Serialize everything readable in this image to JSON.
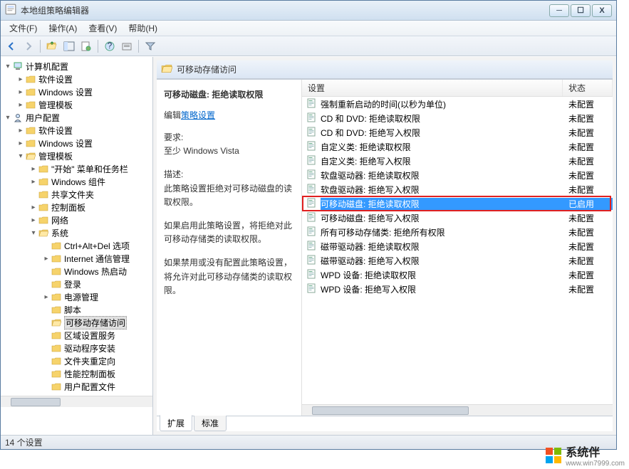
{
  "window": {
    "title": "本地组策略编辑器",
    "controls": {
      "min": "─",
      "max": "☐",
      "close": "X"
    }
  },
  "menu": {
    "file": "文件(F)",
    "action": "操作(A)",
    "view": "查看(V)",
    "help": "帮助(H)"
  },
  "tree": {
    "root1": "计算机配置",
    "r1_soft": "软件设置",
    "r1_win": "Windows 设置",
    "r1_admin": "管理模板",
    "root2": "用户配置",
    "r2_soft": "软件设置",
    "r2_win": "Windows 设置",
    "r2_admin": "管理模板",
    "start": "\"开始\" 菜单和任务栏",
    "wincomp": "Windows 组件",
    "shared": "共享文件夹",
    "ctrlpanel": "控制面板",
    "network": "网络",
    "system": "系统",
    "cad": "Ctrl+Alt+Del 选项",
    "inetcomm": "Internet 通信管理",
    "hotstart": "Windows 热启动",
    "login": "登录",
    "power": "电源管理",
    "script": "脚本",
    "removable": "可移动存储访问",
    "regional": "区域设置服务",
    "driver": "驱动程序安装",
    "folderredir": "文件夹重定向",
    "perfpanel": "性能控制面板",
    "userprofile": "用户配置文件"
  },
  "header": {
    "title": "可移动存储访问"
  },
  "desc": {
    "policy_title": "可移动磁盘: 拒绝读取权限",
    "edit_prefix": "编辑",
    "edit_link": "策略设置",
    "req_label": "要求:",
    "req_value": "至少 Windows Vista",
    "desc_label": "描述:",
    "desc_body1": "此策略设置拒绝对可移动磁盘的读取权限。",
    "desc_body2": "如果启用此策略设置，将拒绝对此可移动存储类的读取权限。",
    "desc_body3": "如果禁用或没有配置此策略设置，将允许对此可移动存储类的读取权限。"
  },
  "columns": {
    "name": "设置",
    "state": "状态"
  },
  "policies": [
    {
      "name": "强制重新启动的时间(以秒为单位)",
      "state": "未配置"
    },
    {
      "name": "CD 和 DVD: 拒绝读取权限",
      "state": "未配置"
    },
    {
      "name": "CD 和 DVD: 拒绝写入权限",
      "state": "未配置"
    },
    {
      "name": "自定义类: 拒绝读取权限",
      "state": "未配置"
    },
    {
      "name": "自定义类: 拒绝写入权限",
      "state": "未配置"
    },
    {
      "name": "软盘驱动器: 拒绝读取权限",
      "state": "未配置"
    },
    {
      "name": "软盘驱动器: 拒绝写入权限",
      "state": "未配置"
    },
    {
      "name": "可移动磁盘: 拒绝读取权限",
      "state": "已启用",
      "highlight": true
    },
    {
      "name": "可移动磁盘: 拒绝写入权限",
      "state": "未配置"
    },
    {
      "name": "所有可移动存储类: 拒绝所有权限",
      "state": "未配置"
    },
    {
      "name": "磁带驱动器: 拒绝读取权限",
      "state": "未配置"
    },
    {
      "name": "磁带驱动器: 拒绝写入权限",
      "state": "未配置"
    },
    {
      "name": "WPD 设备: 拒绝读取权限",
      "state": "未配置"
    },
    {
      "name": "WPD 设备: 拒绝写入权限",
      "state": "未配置"
    }
  ],
  "tabs": {
    "extended": "扩展",
    "standard": "标准"
  },
  "status": {
    "count": "14 个设置"
  },
  "watermark": {
    "brand": "系统伴",
    "sub": "www.win7999.com"
  }
}
